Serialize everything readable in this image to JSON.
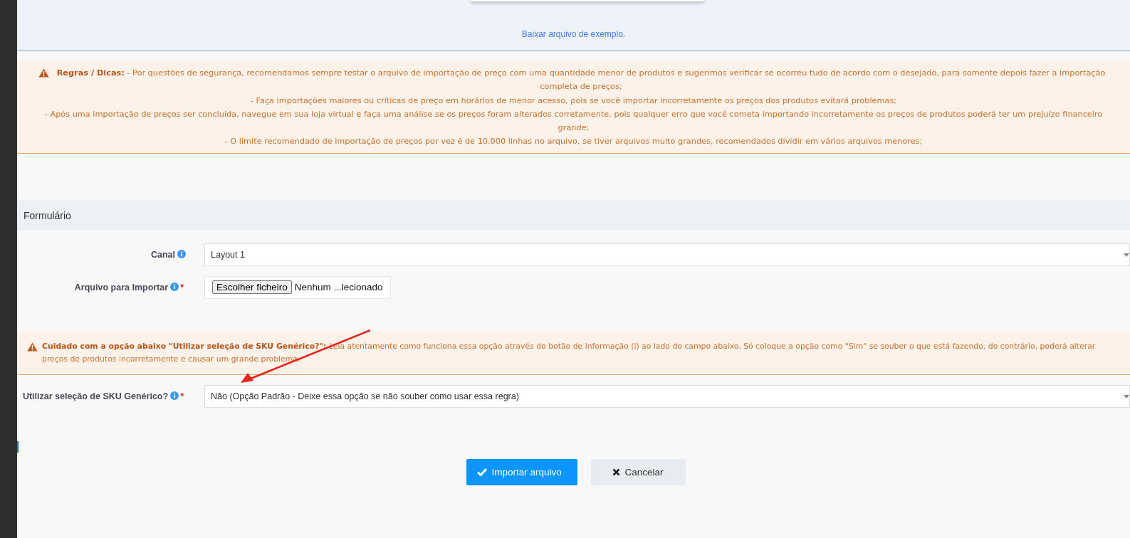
{
  "download_link": "Baixar arquivo de exemplo.",
  "rules_alert": {
    "kind": "centered",
    "items": [
      "**Regras / Dicas:**  - Por questões de segurança, recomendamos sempre testar o arquivo de importação de preço com uma quantidade menor de produtos e sugerimos verificar se ocorreu tudo de acordo com o desejado, para somente depois fazer a importação completa de preços;",
      "- Faça importações maiores ou críticas de preço em horários de menor acesso, pois se você importar incorretamente os preços dos produtos evitará problemas;",
      "- Após uma importação de preços ser concluída, navegue em sua loja virtual e faça uma análise se os preços foram alterados corretamente, pois qualquer erro que você cometa importando incorretamente os preços de produtos poderá ter um prejuízo financeiro grande;",
      "- O limite recomendado de importação de preços por vez é de 10.000 linhas no arquivo, se tiver arquivos muito grandes, recomendados dividir em vários arquivos menores;"
    ]
  },
  "form_title": "Formulário",
  "fields": [
    {
      "kind": "select",
      "label": "Canal",
      "value": "Layout 1"
    },
    {
      "kind": "file",
      "label": "Arquivo para Importar",
      "required_mark": "*",
      "button": "Escolher ficheiro",
      "value": "Nenhum ...lecionado"
    }
  ],
  "caution_alert": {
    "kind": "left",
    "items": [
      "**Cuidado com a opção abaixo \"Utilizar seleção de SKU Genérico?\":**  Leia atentamente como funciona essa opção através do botão de informação (i) ao lado do campo abaixo. Só coloque a opção como \"Sim\" se souber o que está fazendo, do contrário, poderá alterar preços de produtos incorretamente e causar um grande problema."
    ]
  },
  "sku_field": {
    "kind": "select",
    "label": "Utilizar seleção de SKU Genérico?",
    "required_mark": "*",
    "value": "Não (Opção Padrão - Deixe essa opção se não souber como usar essa regra)"
  },
  "buttons": [
    {
      "kind": "primary",
      "label": "Importar arquivo"
    },
    {
      "kind": "secondary",
      "label": "Cancelar"
    }
  ]
}
